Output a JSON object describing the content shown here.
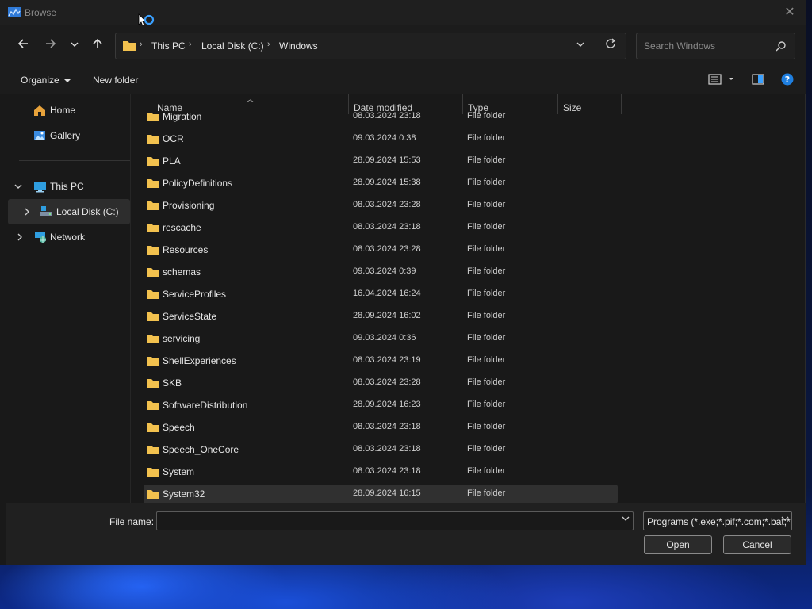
{
  "window": {
    "title": "Browse",
    "close_glyph": "✕"
  },
  "nav": {
    "back": "back-arrow-icon",
    "forward": "forward-arrow-icon",
    "recent": "chevron-down-icon",
    "up": "up-arrow-icon"
  },
  "address": {
    "crumbs": [
      "This PC",
      "Local Disk (C:)",
      "Windows"
    ],
    "separator": "›"
  },
  "search": {
    "placeholder": "Search Windows"
  },
  "commands": {
    "organize": "Organize",
    "new_folder": "New folder"
  },
  "sidebar": {
    "items": [
      {
        "label": "Home",
        "icon": "home-icon"
      },
      {
        "label": "Gallery",
        "icon": "gallery-icon"
      },
      {
        "label": "This PC",
        "icon": "computer-icon",
        "expanded": true
      },
      {
        "label": "Local Disk (C:)",
        "icon": "drive-icon",
        "selected": true
      },
      {
        "label": "Network",
        "icon": "network-icon"
      }
    ]
  },
  "columns": [
    "Name",
    "Date modified",
    "Type",
    "Size"
  ],
  "rows": [
    {
      "name": "Migration",
      "date": "08.03.2024 23:18",
      "type": "File folder"
    },
    {
      "name": "OCR",
      "date": "09.03.2024 0:38",
      "type": "File folder"
    },
    {
      "name": "PLA",
      "date": "28.09.2024 15:53",
      "type": "File folder"
    },
    {
      "name": "PolicyDefinitions",
      "date": "28.09.2024 15:38",
      "type": "File folder"
    },
    {
      "name": "Provisioning",
      "date": "08.03.2024 23:28",
      "type": "File folder"
    },
    {
      "name": "rescache",
      "date": "08.03.2024 23:18",
      "type": "File folder"
    },
    {
      "name": "Resources",
      "date": "08.03.2024 23:28",
      "type": "File folder"
    },
    {
      "name": "schemas",
      "date": "09.03.2024 0:39",
      "type": "File folder"
    },
    {
      "name": "ServiceProfiles",
      "date": "16.04.2024 16:24",
      "type": "File folder"
    },
    {
      "name": "ServiceState",
      "date": "28.09.2024 16:02",
      "type": "File folder"
    },
    {
      "name": "servicing",
      "date": "09.03.2024 0:36",
      "type": "File folder"
    },
    {
      "name": "ShellExperiences",
      "date": "08.03.2024 23:19",
      "type": "File folder"
    },
    {
      "name": "SKB",
      "date": "08.03.2024 23:28",
      "type": "File folder"
    },
    {
      "name": "SoftwareDistribution",
      "date": "28.09.2024 16:23",
      "type": "File folder"
    },
    {
      "name": "Speech",
      "date": "08.03.2024 23:18",
      "type": "File folder"
    },
    {
      "name": "Speech_OneCore",
      "date": "08.03.2024 23:18",
      "type": "File folder"
    },
    {
      "name": "System",
      "date": "08.03.2024 23:18",
      "type": "File folder"
    },
    {
      "name": "System32",
      "date": "28.09.2024 16:15",
      "type": "File folder",
      "selected": true
    }
  ],
  "footer": {
    "file_name_label": "File name:",
    "file_name_value": "",
    "filter": "Programs (*.exe;*.pif;*.com;*.bat;*.cmd)",
    "open": "Open",
    "cancel": "Cancel"
  },
  "colors": {
    "accent": "#0078d4",
    "folder": "#f2c14e",
    "background": "#191919"
  }
}
